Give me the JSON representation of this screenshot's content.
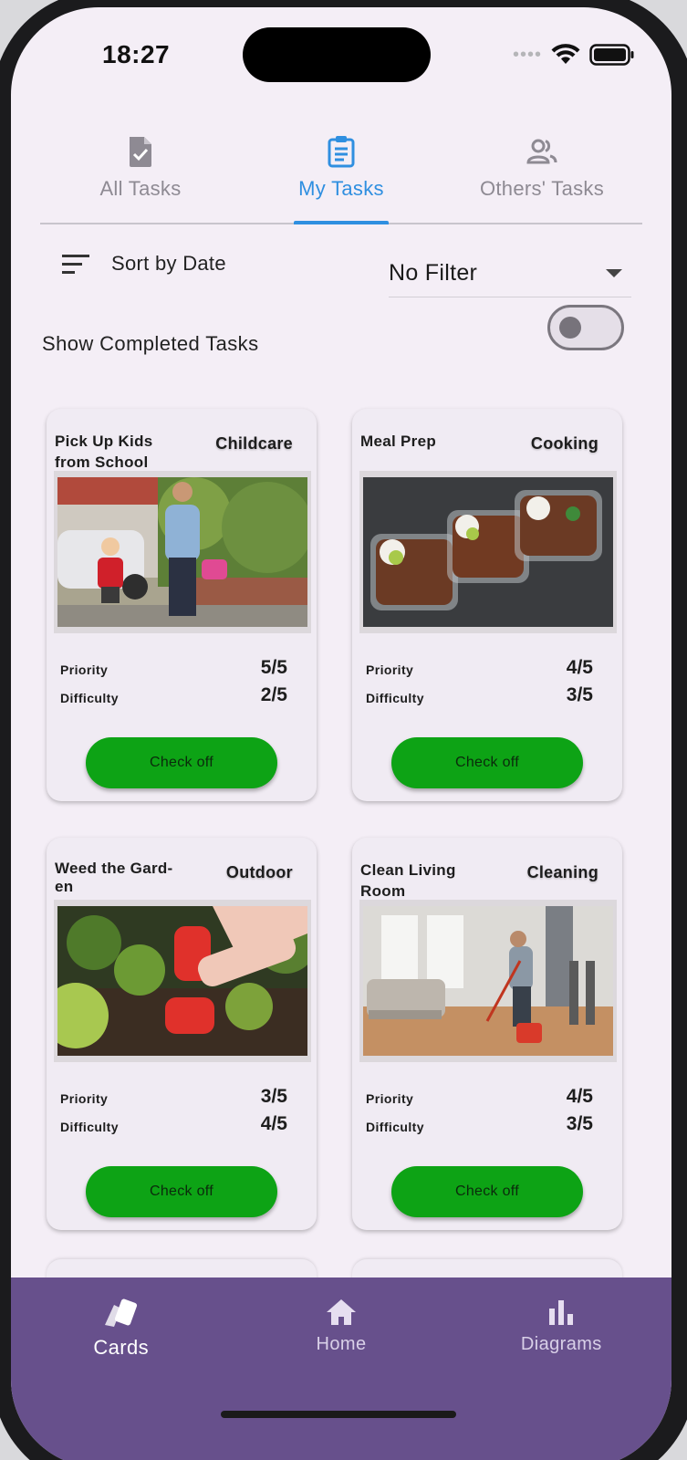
{
  "status_bar": {
    "time": "18:27",
    "signal_dots": "••••"
  },
  "tabs": [
    {
      "label": "All Tasks",
      "icon": "document-check-icon",
      "active": false
    },
    {
      "label": "My Tasks",
      "icon": "clipboard-list-icon",
      "active": true
    },
    {
      "label": "Others' Tasks",
      "icon": "people-icon",
      "active": false
    }
  ],
  "sort": {
    "label": "Sort by Date",
    "icon": "sort-lines-icon"
  },
  "filter": {
    "value": "No Filter"
  },
  "completed_toggle": {
    "label": "Show Completed Tasks",
    "on": false
  },
  "cards": [
    {
      "title": "Pick Up Kids from School",
      "category": "Childcare",
      "image": "parent-walking-child-photo",
      "priority_label": "Priority",
      "priority": "5/5",
      "difficulty_label": "Difficulty",
      "difficulty": "2/5",
      "button": "Check off"
    },
    {
      "title": "Meal Prep",
      "category": "Cooking",
      "image": "meal-prep-containers-photo",
      "priority_label": "Priority",
      "priority": "4/5",
      "difficulty_label": "Difficulty",
      "difficulty": "3/5",
      "button": "Check off"
    },
    {
      "title": "Weed the Gard-\nen",
      "category": "Outdoor",
      "image": "gloved-hand-weeding-photo",
      "priority_label": "Priority",
      "priority": "3/5",
      "difficulty_label": "Difficulty",
      "difficulty": "4/5",
      "button": "Check off"
    },
    {
      "title": "Clean Living\nRoom",
      "category": "Cleaning",
      "image": "man-mopping-living-room-photo",
      "priority_label": "Priority",
      "priority": "4/5",
      "difficulty_label": "Difficulty",
      "difficulty": "3/5",
      "button": "Check off"
    }
  ],
  "bottom_nav": [
    {
      "label": "Cards",
      "icon": "cards-icon",
      "active": true
    },
    {
      "label": "Home",
      "icon": "home-icon",
      "active": false
    },
    {
      "label": "Diagrams",
      "icon": "bar-chart-icon",
      "active": false
    }
  ],
  "colors": {
    "accent_blue": "#2f8fe0",
    "check_button_green": "#0da315",
    "bottom_nav_purple": "#67508c",
    "background": "#f4eef6"
  }
}
